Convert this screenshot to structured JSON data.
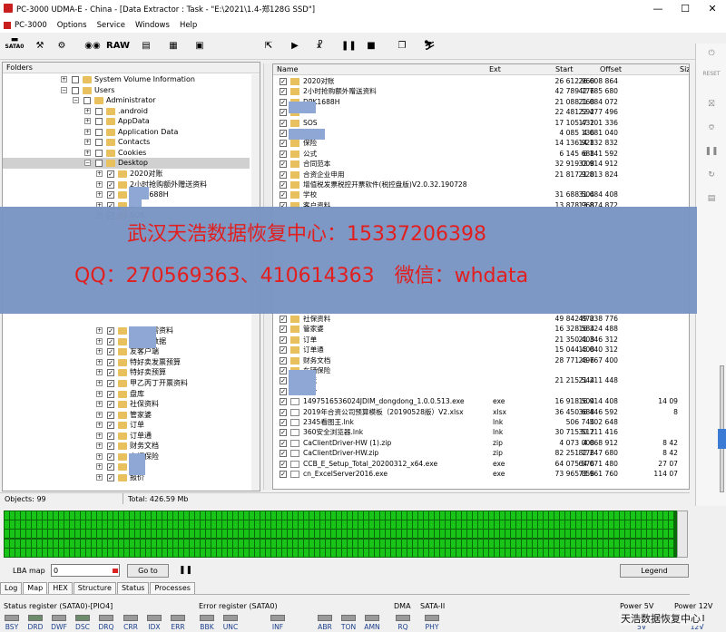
{
  "titlebar": {
    "title": "PC-3000 UDMA-E - China - [Data Extractor : Task - \"E:\\2021\\1.4-郑128G SSD\"]",
    "min": "—",
    "max": "☐",
    "close": "✕"
  },
  "menu": [
    "PC-3000",
    "Options",
    "Service",
    "Windows",
    "Help"
  ],
  "toolbar": {
    "sata": "SATA0",
    "raw": "RAW"
  },
  "folders": {
    "header": "Folders",
    "tree": [
      {
        "label": "System Volume Information",
        "d": 5
      },
      {
        "label": "Users",
        "d": 5,
        "exp": true
      },
      {
        "label": "Administrator",
        "d": 6,
        "exp": true
      },
      {
        "label": ".android",
        "d": 7
      },
      {
        "label": "AppData",
        "d": 7
      },
      {
        "label": "Application Data",
        "d": 7
      },
      {
        "label": "Contacts",
        "d": 7
      },
      {
        "label": "Cookies",
        "d": 7
      },
      {
        "label": "Desktop",
        "d": 7,
        "exp": true,
        "sel": true
      },
      {
        "label": "2020对账",
        "d": 8
      },
      {
        "label": "2小时抢购额外赠送资料",
        "d": 8
      },
      {
        "label": "DPK1688H",
        "d": 8
      },
      {
        "label": "D",
        "d": 8
      },
      {
        "label": "SOS",
        "d": 8
      },
      {
        "label": "承兑所需资料",
        "d": 8
      },
      {
        "label": "新EBR数据",
        "d": 8
      },
      {
        "label": "友客户端",
        "d": 8
      },
      {
        "label": "特好卖发票预算",
        "d": 8
      },
      {
        "label": "特好卖预算",
        "d": 8
      },
      {
        "label": "甲乙丙丁开票资料",
        "d": 8
      },
      {
        "label": "盘库",
        "d": 8
      },
      {
        "label": "社保资料",
        "d": 8
      },
      {
        "label": "管家婆",
        "d": 8
      },
      {
        "label": "订单",
        "d": 8
      },
      {
        "label": "订单通",
        "d": 8
      },
      {
        "label": "财务文档",
        "d": 8
      },
      {
        "label": "车辆保险",
        "d": 8
      },
      {
        "label": "对账",
        "d": 8
      },
      {
        "label": "报价",
        "d": 8
      }
    ]
  },
  "files": {
    "columns": [
      "Name",
      "Ext",
      "Start",
      "Offset",
      "Siz"
    ],
    "rows_top": [
      {
        "name": "2020对账",
        "ext": "",
        "start": "26 612 960",
        "offset": "26 608 864",
        "size": ""
      },
      {
        "name": "2小时抢购额外赠送资料",
        "ext": "",
        "start": "42 789 776",
        "offset": "42 785 680",
        "size": ""
      },
      {
        "name": "DPK1688H",
        "ext": "",
        "start": "21 088 168",
        "offset": "21 084 072",
        "size": ""
      },
      {
        "name": "",
        "ext": "",
        "start": "22 481 592",
        "offset": "22 477 496",
        "size": ""
      },
      {
        "name": "SOS",
        "ext": "",
        "start": "17 105 432",
        "offset": "17 101 336",
        "size": ""
      },
      {
        "name": "",
        "ext": "",
        "start": "4 085 136",
        "offset": "4 081 040",
        "size": ""
      },
      {
        "name": "保险",
        "ext": "",
        "start": "14 136 928",
        "offset": "14 132 832",
        "size": ""
      },
      {
        "name": "公式",
        "ext": "",
        "start": "6 145 688",
        "offset": "6 141 592",
        "size": ""
      },
      {
        "name": "合同范本",
        "ext": "",
        "start": "32 919 008",
        "offset": "32 914 912",
        "size": ""
      },
      {
        "name": "合资企业申用",
        "ext": "",
        "start": "21 817 920",
        "offset": "21 813 824",
        "size": ""
      },
      {
        "name": "增值税发票税控开票软件(税控盘版)V2.0.32.190728",
        "ext": "",
        "start": "",
        "offset": "",
        "size": ""
      },
      {
        "name": "学校",
        "ext": "",
        "start": "31 688 504",
        "offset": "31 684 408",
        "size": ""
      },
      {
        "name": "客户资料",
        "ext": "",
        "start": "13 878 968",
        "offset": "13 874 872",
        "size": ""
      }
    ],
    "rows_bottom": [
      {
        "name": "社保资料",
        "ext": "",
        "start": "49 842 872",
        "offset": "49 838 776",
        "size": "",
        "file": false
      },
      {
        "name": "管家婆",
        "ext": "",
        "start": "16 328 584",
        "offset": "16 324 488",
        "size": "",
        "file": false
      },
      {
        "name": "订单",
        "ext": "",
        "start": "21 350 408",
        "offset": "21 346 312",
        "size": "",
        "file": false
      },
      {
        "name": "订单通",
        "ext": "",
        "start": "15 044 408",
        "offset": "15 040 312",
        "size": "",
        "file": false
      },
      {
        "name": "财务文档",
        "ext": "",
        "start": "28 771 496",
        "offset": "28 767 400",
        "size": "",
        "file": false
      },
      {
        "name": "车辆保险",
        "ext": "",
        "start": "",
        "offset": "",
        "size": "",
        "file": false
      },
      {
        "name": "对账",
        "ext": "",
        "start": "21 215 544",
        "offset": "21 211 448",
        "size": "",
        "file": false
      },
      {
        "name": "报价",
        "ext": "",
        "start": "",
        "offset": "",
        "size": "",
        "file": false
      },
      {
        "name": "1497516536024JDIM_dongdong_1.0.0.513.exe",
        "ext": "exe",
        "start": "16 918 504",
        "offset": "16 914 408",
        "size": "14 09",
        "file": true
      },
      {
        "name": "2019年合资公司预算模板（20190528版）V2.xlsx",
        "ext": "xlsx",
        "start": "36 450 688",
        "offset": "36 446 592",
        "size": "8",
        "file": true
      },
      {
        "name": "2345看图王.lnk",
        "ext": "lnk",
        "start": "506 744",
        "offset": "502 648",
        "size": "",
        "file": true
      },
      {
        "name": "360安全浏览器.lnk",
        "ext": "lnk",
        "start": "30 715 512",
        "offset": "30 711 416",
        "size": "",
        "file": true
      },
      {
        "name": "CaClientDriver-HW (1).zip",
        "ext": "zip",
        "start": "4 073 008",
        "offset": "4 068 912",
        "size": "8 42",
        "file": true
      },
      {
        "name": "CaClientDriver-HW.zip",
        "ext": "zip",
        "start": "82 251 776",
        "offset": "82 247 680",
        "size": "8 42",
        "file": true
      },
      {
        "name": "CCB_E_Setup_Total_20200312_x64.exe",
        "ext": "exe",
        "start": "64 075 576",
        "offset": "64 071 480",
        "size": "27 07",
        "file": true
      },
      {
        "name": "cn_ExcelServer2016.exe",
        "ext": "exe",
        "start": "73 965 856",
        "offset": "73 961 760",
        "size": "114 07",
        "file": true
      }
    ]
  },
  "status": {
    "objects": "Objects: 99",
    "total": "Total: 426.59 Mb"
  },
  "lba": {
    "label": "LBA map",
    "value": "0",
    "goto": "Go to",
    "legend": "Legend"
  },
  "tabs": [
    "Log",
    "Map",
    "HEX",
    "Structure",
    "Status",
    "Processes"
  ],
  "regs": {
    "status_title": "Status register (SATA0)-[PIO4]",
    "error_title": "Error register (SATA0)",
    "dma_title": "DMA",
    "sata2_title": "SATA-II",
    "p5_title": "Power 5V",
    "p12_title": "Power 12V",
    "status_leds": [
      "BSY",
      "DRD",
      "DWF",
      "DSC",
      "DRQ",
      "CRR",
      "IDX",
      "ERR"
    ],
    "error_leds": [
      "BBK",
      "UNC",
      "INF",
      "ABR",
      "TON",
      "AMN"
    ],
    "dma_led": "RQ",
    "sata_led": "PHY",
    "p5": "5V",
    "p12": "12V"
  },
  "banner": {
    "line1": "武汉天浩数据恢复中心：15337206398",
    "line2": "QQ：270569363、410614363　微信：whdata"
  },
  "brand": "天浩数据恢复中心",
  "colors": {
    "map_block": "#19c419",
    "banner": "#7a95c4",
    "banner_text": "#e11818"
  }
}
